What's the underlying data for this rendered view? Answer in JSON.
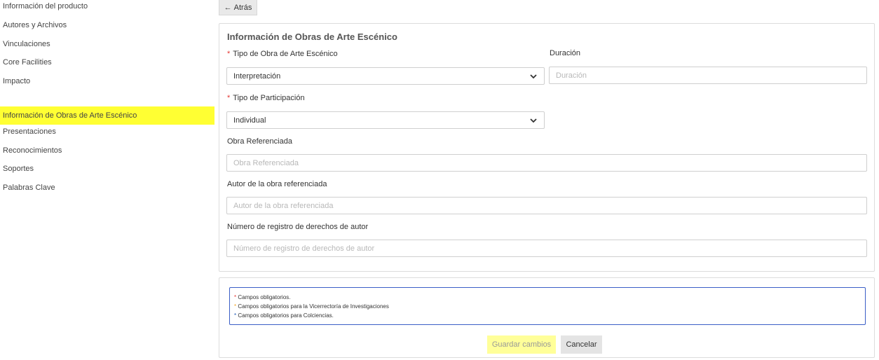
{
  "sidebar": {
    "group1": [
      {
        "label": "Información del producto"
      },
      {
        "label": "Autores y Archivos"
      },
      {
        "label": "Vinculaciones"
      },
      {
        "label": "Core Facilities"
      },
      {
        "label": "Impacto"
      }
    ],
    "group2": [
      {
        "label": "Información de Obras de Arte Escénico",
        "active": true
      },
      {
        "label": "Presentaciones"
      },
      {
        "label": "Reconocimientos"
      },
      {
        "label": "Soportes"
      },
      {
        "label": "Palabras Clave"
      }
    ],
    "active_color": "#ffff33"
  },
  "back_button": {
    "arrow": "←",
    "label": "Atrás"
  },
  "form": {
    "title": "Información de Obras de Arte Escénico",
    "required_mark": "*",
    "tipo_obra": {
      "label": "Tipo de Obra de Arte Escénico",
      "value": "Interpretación"
    },
    "duracion": {
      "label": "Duración",
      "placeholder": "Duración",
      "value": ""
    },
    "tipo_participacion": {
      "label": "Tipo de Participación",
      "value": "Individual"
    },
    "obra_referenciada": {
      "label": "Obra Referenciada",
      "placeholder": "Obra Referenciada",
      "value": ""
    },
    "autor_obra": {
      "label": "Autor de la obra referenciada",
      "placeholder": "Autor de la obra referenciada",
      "value": ""
    },
    "numero_registro": {
      "label": "Número de registro de derechos de autor",
      "placeholder": "Número de registro de derechos de autor",
      "value": ""
    }
  },
  "notes": {
    "items": [
      {
        "star": "*",
        "color": "#e53935",
        "text": "Campos obligatorios."
      },
      {
        "star": "*",
        "color": "#f5a623",
        "text": "Campos obligatorios para la Vicerrectoría de Investigaciones"
      },
      {
        "star": "*",
        "color": "#1e5bb8",
        "text": "Campos obligatorios para Colciencias."
      }
    ]
  },
  "actions": {
    "save_label": "Guardar cambios",
    "cancel_label": "Cancelar"
  },
  "icons": {
    "back": "arrow-left-icon",
    "select": "chevron-down-icon"
  }
}
